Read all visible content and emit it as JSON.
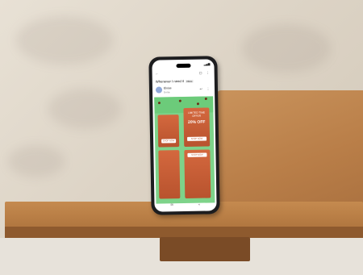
{
  "phone": {
    "status": {
      "time": "",
      "icons": "▂▄▆"
    },
    "toolbar": {
      "back": "←",
      "actions": "▢ ⋮"
    },
    "email": {
      "subject": "Whenever I need it",
      "badge": "Inbox",
      "sender": "Eloise",
      "to": "to me",
      "actions": "↩ ⋮"
    },
    "promo": {
      "card_title": "LIMITED TIME OFFER",
      "card_price": "20% OFF",
      "card_button_1": "SHOP NOW",
      "card_button_2": "SHOP NOW",
      "card_button_3": "SHOP NOW"
    },
    "nav": {
      "left": "✉",
      "right": "◐"
    }
  },
  "colors": {
    "wall": "#ddd4c6",
    "wood": "#b97e48",
    "phone_body": "#1d1d1f",
    "email_bg": "#7ed38a",
    "card": "#c85c34"
  }
}
